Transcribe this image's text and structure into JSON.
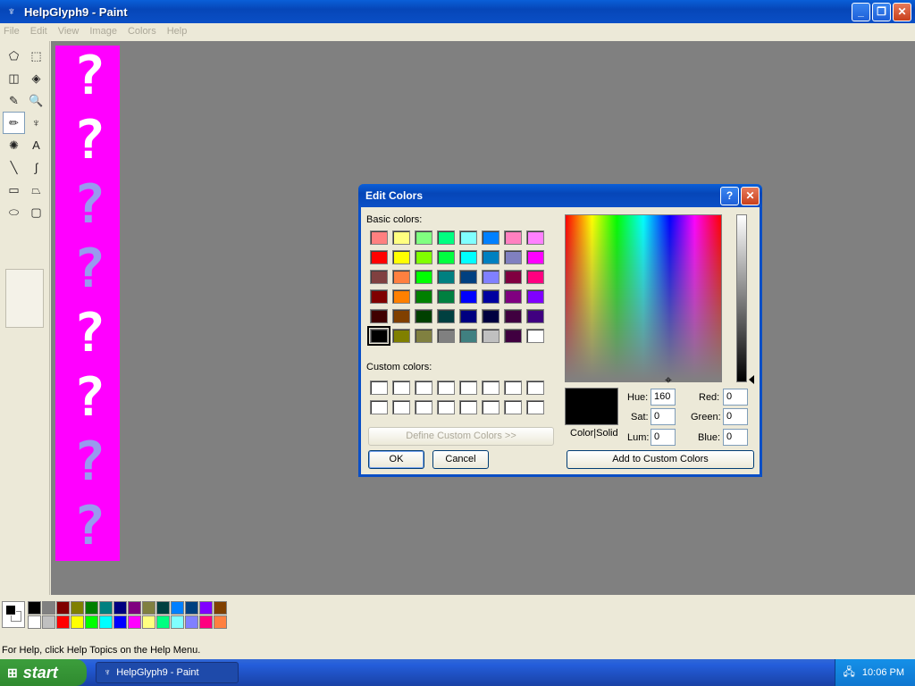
{
  "window": {
    "title": "HelpGlyph9 - Paint",
    "minimize": "_",
    "maximize": "❐",
    "close": "✕"
  },
  "menu": [
    "File",
    "Edit",
    "View",
    "Image",
    "Colors",
    "Help"
  ],
  "tools": [
    {
      "name": "free-form-select-icon",
      "glyph": "⬠"
    },
    {
      "name": "select-icon",
      "glyph": "⬚"
    },
    {
      "name": "eraser-icon",
      "glyph": "◫"
    },
    {
      "name": "fill-icon",
      "glyph": "◈"
    },
    {
      "name": "pick-color-icon",
      "glyph": "✎"
    },
    {
      "name": "magnifier-icon",
      "glyph": "🔍"
    },
    {
      "name": "pencil-icon",
      "glyph": "✏"
    },
    {
      "name": "brush-icon",
      "glyph": "♆"
    },
    {
      "name": "airbrush-icon",
      "glyph": "✺"
    },
    {
      "name": "text-icon",
      "glyph": "A"
    },
    {
      "name": "line-icon",
      "glyph": "╲"
    },
    {
      "name": "curve-icon",
      "glyph": "∫"
    },
    {
      "name": "rectangle-icon",
      "glyph": "▭"
    },
    {
      "name": "polygon-icon",
      "glyph": "⏢"
    },
    {
      "name": "ellipse-icon",
      "glyph": "⬭"
    },
    {
      "name": "rounded-rectangle-icon",
      "glyph": "▢"
    }
  ],
  "selected_tool": "pencil-icon",
  "canvas": {
    "background": "#ff00ff",
    "glyph_char": "?",
    "glyph_colors": [
      "#ffffff",
      "#ffffff",
      "#9999ee",
      "#9999ee",
      "#ffffff",
      "#ffffff",
      "#9999ee",
      "#9999ee"
    ]
  },
  "palette": {
    "foreground": "#000000",
    "background": "#ffffff",
    "top": [
      "#000000",
      "#808080",
      "#800000",
      "#808000",
      "#008000",
      "#008080",
      "#000080",
      "#800080",
      "#808040",
      "#004040",
      "#0080ff",
      "#004080",
      "#8000ff",
      "#804000"
    ],
    "bottom": [
      "#ffffff",
      "#c0c0c0",
      "#ff0000",
      "#ffff00",
      "#00ff00",
      "#00ffff",
      "#0000ff",
      "#ff00ff",
      "#ffff80",
      "#00ff80",
      "#80ffff",
      "#8080ff",
      "#ff0080",
      "#ff8040"
    ]
  },
  "status": "For Help, click Help Topics on the Help Menu.",
  "taskbar": {
    "start": "start",
    "task": "HelpGlyph9 - Paint",
    "time": "10:06 PM"
  },
  "dialog": {
    "title": "Edit Colors",
    "help": "?",
    "close": "✕",
    "basic_label": "Basic colors:",
    "custom_label": "Custom colors:",
    "basic_colors": [
      "#ff8080",
      "#ffff80",
      "#80ff80",
      "#00ff80",
      "#80ffff",
      "#0080ff",
      "#ff80c0",
      "#ff80ff",
      "#ff0000",
      "#ffff00",
      "#80ff00",
      "#00ff40",
      "#00ffff",
      "#0080c0",
      "#8080c0",
      "#ff00ff",
      "#804040",
      "#ff8040",
      "#00ff00",
      "#008080",
      "#004080",
      "#8080ff",
      "#800040",
      "#ff0080",
      "#800000",
      "#ff8000",
      "#008000",
      "#008040",
      "#0000ff",
      "#0000a0",
      "#800080",
      "#8000ff",
      "#400000",
      "#804000",
      "#004000",
      "#004040",
      "#000080",
      "#000040",
      "#400040",
      "#400080",
      "#000000",
      "#808000",
      "#808040",
      "#808080",
      "#408080",
      "#c0c0c0",
      "#400040",
      "#ffffff"
    ],
    "selected_basic_index": 40,
    "custom_count": 16,
    "define_custom": "Define Custom Colors >>",
    "ok": "OK",
    "cancel": "Cancel",
    "color_solid": "Color|Solid",
    "add_custom": "Add to Custom Colors",
    "fields": {
      "hue_label": "Hue:",
      "hue": "160",
      "sat_label": "Sat:",
      "sat": "0",
      "lum_label": "Lum:",
      "lum": "0",
      "red_label": "Red:",
      "red": "0",
      "green_label": "Green:",
      "green": "0",
      "blue_label": "Blue:",
      "blue": "0"
    }
  }
}
